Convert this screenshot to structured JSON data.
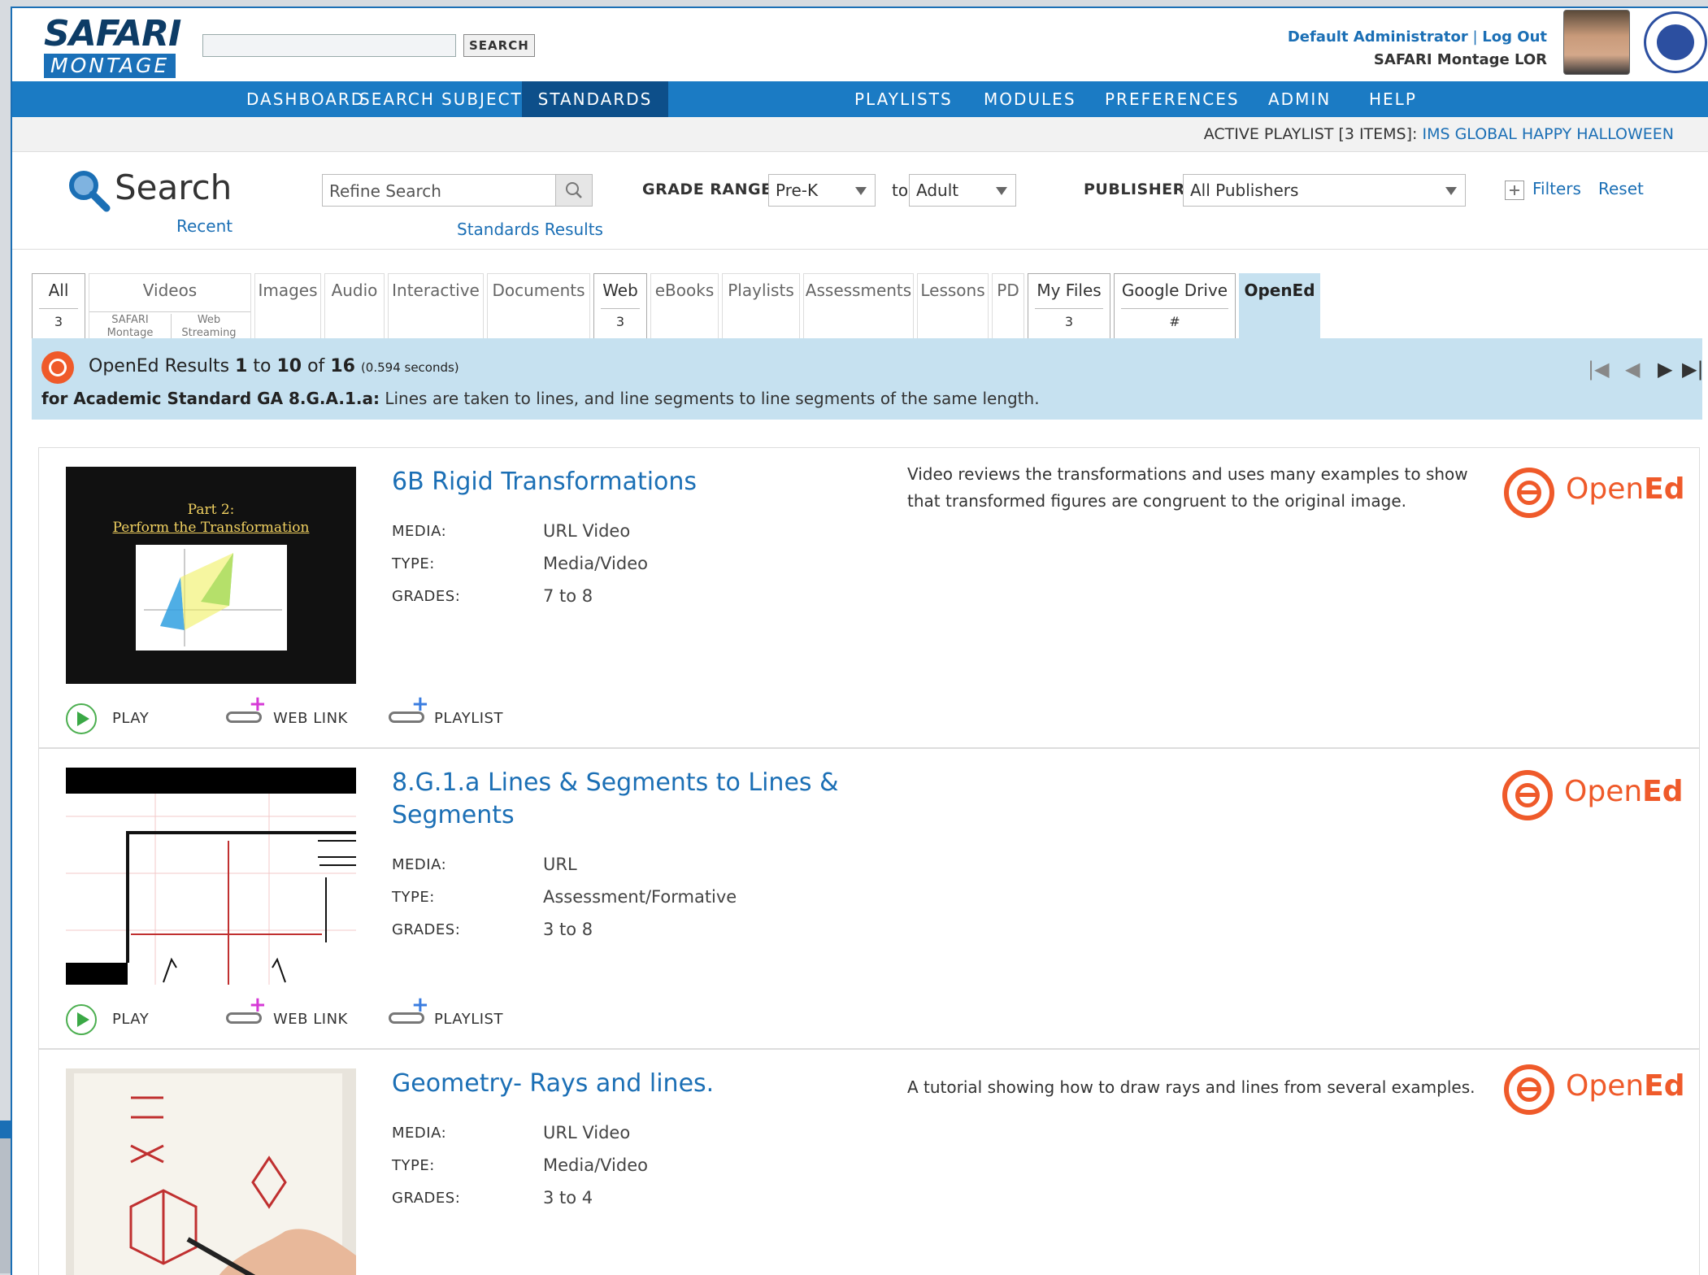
{
  "header": {
    "logo_top": "SAFARI",
    "logo_bottom": "MONTAGE",
    "search_button": "SEARCH",
    "user_name": "Default Administrator",
    "separator": "|",
    "logout": "Log Out",
    "site": "SAFARI Montage LOR"
  },
  "nav": [
    "DASHBOARD",
    "SEARCH",
    "SUBJECTS",
    "STANDARDS",
    "PLAYLISTS",
    "MODULES",
    "PREFERENCES",
    "ADMIN",
    "HELP"
  ],
  "nav_active": "STANDARDS",
  "playlist_bar": {
    "label": "ACTIVE PLAYLIST [3 ITEMS]:",
    "name": "IMS GLOBAL HAPPY HALLOWEEN"
  },
  "search_panel": {
    "title": "Search",
    "recent": "Recent",
    "refine_placeholder": "Refine Search",
    "standards_results": "Standards Results",
    "grade_range_label": "GRADE RANGE:",
    "grade_from": "Pre-K",
    "to": "to",
    "grade_to": "Adult",
    "publisher_label": "PUBLISHER:",
    "publisher": "All Publishers",
    "filters": "Filters",
    "reset": "Reset"
  },
  "tabs": {
    "all": {
      "label": "All",
      "count": "3"
    },
    "videos": {
      "label": "Videos",
      "sub1a": "SAFARI",
      "sub1b": "Montage",
      "sub2a": "Web",
      "sub2b": "Streaming"
    },
    "images": "Images",
    "audio": "Audio",
    "interactive": "Interactive",
    "documents": "Documents",
    "web": {
      "label": "Web",
      "count": "3"
    },
    "ebooks": "eBooks",
    "playlists": "Playlists",
    "assessments": "Assessments",
    "lessons": "Lessons",
    "pd": "PD",
    "myfiles": {
      "label": "My Files",
      "count": "3"
    },
    "gdrive": {
      "label": "Google Drive",
      "count": "#"
    },
    "opened": "OpenEd"
  },
  "results": {
    "prefix": "OpenEd Results",
    "from": "1",
    "to_word": "to",
    "to": "10",
    "of_word": "of",
    "total": "16",
    "time": "(0.594 seconds)",
    "standard_label": "for Academic Standard GA 8.G.A.1.a:",
    "standard_text": "Lines are taken to lines, and line segments to line segments of the same length."
  },
  "pager": {
    "first": "|◀",
    "prev": "◀",
    "next": "▶",
    "last": "▶|"
  },
  "labels": {
    "media": "MEDIA:",
    "type": "TYPE:",
    "grades": "GRADES:",
    "play": "PLAY",
    "web_link": "WEB LINK",
    "playlist": "PLAYLIST"
  },
  "provider": {
    "light": "Open",
    "bold": "Ed"
  },
  "items": [
    {
      "title": "6B Rigid Transformations",
      "media": "URL Video",
      "type": "Media/Video",
      "grades": "7 to 8",
      "desc1": "Video reviews the transformations and uses many examples to show",
      "desc2": "that transformed figures are congruent to the original image.",
      "thumb_line1": "Part 2:",
      "thumb_line2": "Perform the Transformation"
    },
    {
      "title1": "8.G.1.a Lines & Segments to Lines &",
      "title2": "Segments",
      "media": "URL",
      "type": "Assessment/Formative",
      "grades": "3 to 8"
    },
    {
      "title": "Geometry- Rays and lines.",
      "media": "URL Video",
      "type": "Media/Video",
      "grades": "3 to 4",
      "desc1": "A tutorial showing how to draw rays and lines from several examples."
    }
  ],
  "colors": {
    "brand_blue": "#1b7bc4",
    "link": "#1b6fb5",
    "opened_orange": "#ef5a2a",
    "results_bg": "#c6e1f0"
  }
}
